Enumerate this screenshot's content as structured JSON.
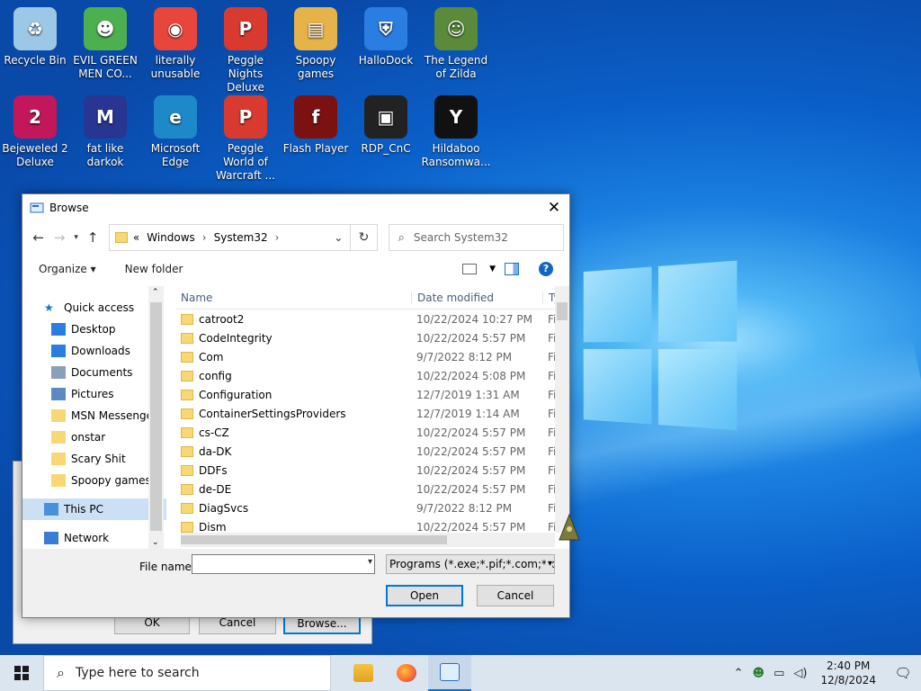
{
  "desktop": {
    "icons": [
      {
        "label": "Recycle Bin",
        "color": "#9cc7e6",
        "glyph": "♻"
      },
      {
        "label": "EVIL GREEN MEN CO...",
        "color": "#4caf50",
        "glyph": "☻"
      },
      {
        "label": "literally unusable",
        "color": "#e8453c",
        "glyph": "◉"
      },
      {
        "label": "Peggle Nights Deluxe",
        "color": "#d83a2f",
        "glyph": "P"
      },
      {
        "label": "Spoopy games",
        "color": "#e6b24a",
        "glyph": "▤"
      },
      {
        "label": "HalloDock",
        "color": "#2a7de1",
        "glyph": "⛨"
      },
      {
        "label": "The Legend of Zilda",
        "color": "#5a8a3a",
        "glyph": "☺"
      },
      {
        "label": "Bejeweled 2 Deluxe",
        "color": "#c2185b",
        "glyph": "2"
      },
      {
        "label": "fat like darkok",
        "color": "#283593",
        "glyph": "M"
      },
      {
        "label": "Microsoft Edge",
        "color": "#1e88c8",
        "glyph": "e"
      },
      {
        "label": "Peggle World of Warcraft ...",
        "color": "#d83a2f",
        "glyph": "P"
      },
      {
        "label": "Flash Player",
        "color": "#7b1111",
        "glyph": "f"
      },
      {
        "label": "RDP_CnC",
        "color": "#222222",
        "glyph": "▣"
      },
      {
        "label": "Hildaboo Ransomwa...",
        "color": "#111111",
        "glyph": "Y"
      }
    ]
  },
  "back_dialog": {
    "ok": "OK",
    "cancel": "Cancel",
    "browse": "Browse..."
  },
  "dialog": {
    "title": "Browse",
    "address": {
      "prefix": "«",
      "crumbs": [
        "Windows",
        "System32"
      ],
      "trail": "›"
    },
    "search_placeholder": "Search System32",
    "organize": "Organize ▾",
    "new_folder": "New folder",
    "nav": [
      {
        "label": "Quick access",
        "icon": "star-icon",
        "pin": false,
        "indent": 24
      },
      {
        "label": "Desktop",
        "icon": "desktop-icon",
        "pin": true,
        "indent": 32
      },
      {
        "label": "Downloads",
        "icon": "download-icon",
        "pin": true,
        "indent": 32
      },
      {
        "label": "Documents",
        "icon": "document-icon",
        "pin": true,
        "indent": 32
      },
      {
        "label": "Pictures",
        "icon": "picture-icon",
        "pin": true,
        "indent": 32
      },
      {
        "label": "MSN Messenger",
        "icon": "folder-icon",
        "pin": false,
        "indent": 32
      },
      {
        "label": "onstar",
        "icon": "folder-icon",
        "pin": false,
        "indent": 32
      },
      {
        "label": "Scary Shit",
        "icon": "folder-icon",
        "pin": false,
        "indent": 32
      },
      {
        "label": "Spoopy games",
        "icon": "folder-icon",
        "pin": false,
        "indent": 32
      },
      {
        "label": "This PC",
        "icon": "pc-icon",
        "pin": false,
        "indent": 24,
        "selected": true
      },
      {
        "label": "Network",
        "icon": "network-icon",
        "pin": false,
        "indent": 24
      }
    ],
    "columns": {
      "name": "Name",
      "date": "Date modified",
      "type": "Ty"
    },
    "files": [
      {
        "name": "catroot2",
        "date": "10/22/2024 10:27 PM",
        "type": "Fi"
      },
      {
        "name": "CodeIntegrity",
        "date": "10/22/2024 5:57 PM",
        "type": "Fi"
      },
      {
        "name": "Com",
        "date": "9/7/2022 8:12 PM",
        "type": "Fi"
      },
      {
        "name": "config",
        "date": "10/22/2024 5:08 PM",
        "type": "Fi"
      },
      {
        "name": "Configuration",
        "date": "12/7/2019 1:31 AM",
        "type": "Fi"
      },
      {
        "name": "ContainerSettingsProviders",
        "date": "12/7/2019 1:14 AM",
        "type": "Fi"
      },
      {
        "name": "cs-CZ",
        "date": "10/22/2024 5:57 PM",
        "type": "Fi"
      },
      {
        "name": "da-DK",
        "date": "10/22/2024 5:57 PM",
        "type": "Fi"
      },
      {
        "name": "DDFs",
        "date": "10/22/2024 5:57 PM",
        "type": "Fi"
      },
      {
        "name": "de-DE",
        "date": "10/22/2024 5:57 PM",
        "type": "Fi"
      },
      {
        "name": "DiagSvcs",
        "date": "9/7/2022 8:12 PM",
        "type": "Fi"
      },
      {
        "name": "Dism",
        "date": "10/22/2024 5:57 PM",
        "type": "Fi"
      }
    ],
    "file_name_label": "File name:",
    "file_name_value": "",
    "file_type": "Programs (*.exe;*.pif;*.com;*.bat;*.cmd)",
    "open": "Open",
    "cancel": "Cancel"
  },
  "taskbar": {
    "search_placeholder": "Type here to search",
    "time": "2:40 PM",
    "date": "12/8/2024"
  }
}
